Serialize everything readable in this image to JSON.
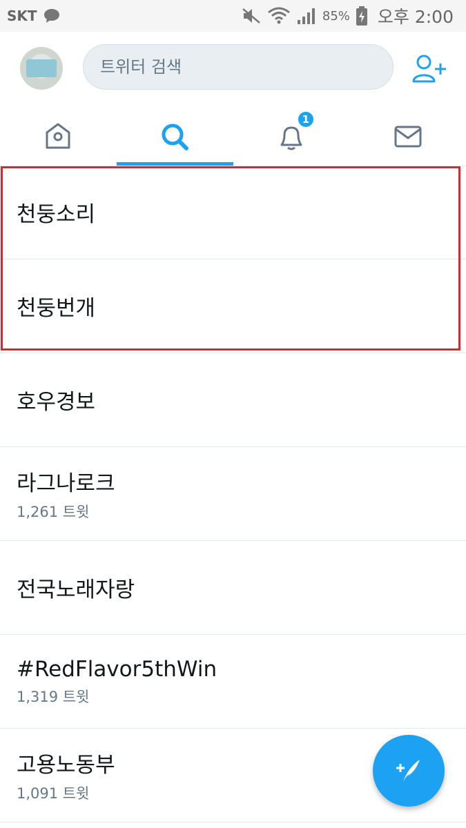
{
  "status_bar": {
    "carrier": "SKT",
    "battery_pct": "85%",
    "time": "오후 2:00"
  },
  "header": {
    "search_placeholder": "트위터 검색"
  },
  "tabs": [
    {
      "name": "home",
      "icon": "home-icon"
    },
    {
      "name": "search",
      "icon": "search-icon",
      "active": true
    },
    {
      "name": "notifications",
      "icon": "bell-icon",
      "badge": "1"
    },
    {
      "name": "messages",
      "icon": "envelope-icon"
    }
  ],
  "list": [
    {
      "title": "천둥소리",
      "count": ""
    },
    {
      "title": "천둥번개",
      "count": ""
    },
    {
      "title": "호우경보",
      "count": ""
    },
    {
      "title": "라그나로크",
      "count": "1,261 트윗"
    },
    {
      "title": "전국노래자랑",
      "count": ""
    },
    {
      "title": "#RedFlavor5thWin",
      "count": "1,319 트윗"
    },
    {
      "title": "고용노동부",
      "count": "1,091 트윗"
    }
  ],
  "colors": {
    "accent": "#1da1f2",
    "highlight": "#e0232d"
  }
}
